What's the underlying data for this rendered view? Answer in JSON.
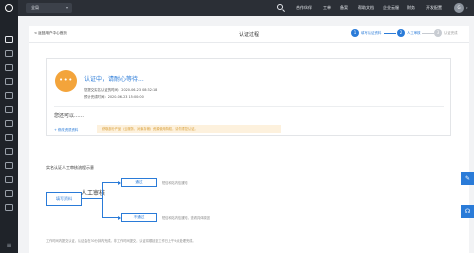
{
  "topbar": {
    "region": "全局",
    "nav": [
      {
        "label": "合作伙伴"
      },
      {
        "label": "工单"
      },
      {
        "label": "备案"
      },
      {
        "label": "帮助文档"
      },
      {
        "label": "企业云服"
      },
      {
        "label": "财务"
      },
      {
        "label": "开发配置"
      }
    ],
    "avatar_letter": "G"
  },
  "page": {
    "back_link": "< 返回用户中心首页",
    "title": "认证过程",
    "steps": [
      {
        "number": "1",
        "label": "填写认证资料"
      },
      {
        "number": "2",
        "label": "人工审核"
      },
      {
        "number": "3",
        "label": "认证完成"
      }
    ]
  },
  "status": {
    "circle_text": "•••",
    "title": "认证中，请耐心等待...",
    "submit_label": "您提交实名认证的时间：",
    "submit_time": "2020-06-23 08:32:18",
    "estimate_label": "预计完成时间：",
    "estimate_time": "2020-06-23 15:00:00",
    "more_title": "您还可以……",
    "more_link": "+ 修改资质资料",
    "notice": "获取部分产品（云服务、对象存储）资源使用特权，请勿重复认证。"
  },
  "flow": {
    "title": "实名认证人工审核流程示意",
    "start_box": "填写资料",
    "review_label": "人工审核",
    "pass_box": "通过",
    "reject_box": "不通过",
    "pass_desc": "短信和站内信通知",
    "reject_desc": "短信和站内信通知，查看具体原因",
    "footer": "工作时间内提交认证，认证会在30分钟内完成。非工作时间提交，认证将顺延至工作日上午9点处理完成。"
  },
  "floating": {
    "edit_icon": "✎",
    "headset_icon": "☊"
  }
}
